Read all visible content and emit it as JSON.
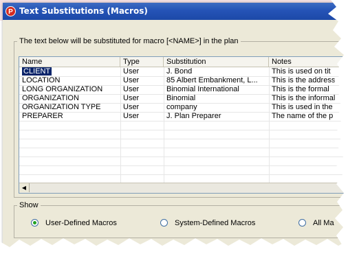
{
  "window": {
    "title": "Text Substitutions (Macros)",
    "icon": "P"
  },
  "macros_group": {
    "legend": "The text below will be substituted for macro [<NAME>] in the plan"
  },
  "table": {
    "columns": [
      "Name",
      "Type",
      "Substitution",
      "Notes"
    ],
    "rows": [
      {
        "name": "CLIENT",
        "type": "User",
        "substitution": "J. Bond",
        "notes": "This is used on tit"
      },
      {
        "name": "LOCATION",
        "type": "User",
        "substitution": "85 Albert Embankment, L...",
        "notes": "This is the address"
      },
      {
        "name": "LONG ORGANIZATION",
        "type": "User",
        "substitution": "Binomial International",
        "notes": "This is the formal"
      },
      {
        "name": "ORGANIZATION",
        "type": "User",
        "substitution": "Binomial",
        "notes": "This is the informal"
      },
      {
        "name": "ORGANIZATION TYPE",
        "type": "User",
        "substitution": "company",
        "notes": "This is used in the"
      },
      {
        "name": "PREPARER",
        "type": "User",
        "substitution": "J. Plan Preparer",
        "notes": "The name of the p"
      }
    ],
    "selected_row": 0
  },
  "show_group": {
    "legend": "Show",
    "options": [
      {
        "label": "User-Defined Macros",
        "selected": true
      },
      {
        "label": "System-Defined Macros",
        "selected": false
      },
      {
        "label": "All Ma",
        "selected": false
      }
    ]
  },
  "colors": {
    "titlebar": "#2553b6",
    "selection": "#0a246a",
    "radio_dot": "#21a121",
    "dialog_bg": "#ece9d8"
  },
  "icons": {
    "app": "planning-app-icon",
    "scroll_left": "arrow-left-icon"
  }
}
